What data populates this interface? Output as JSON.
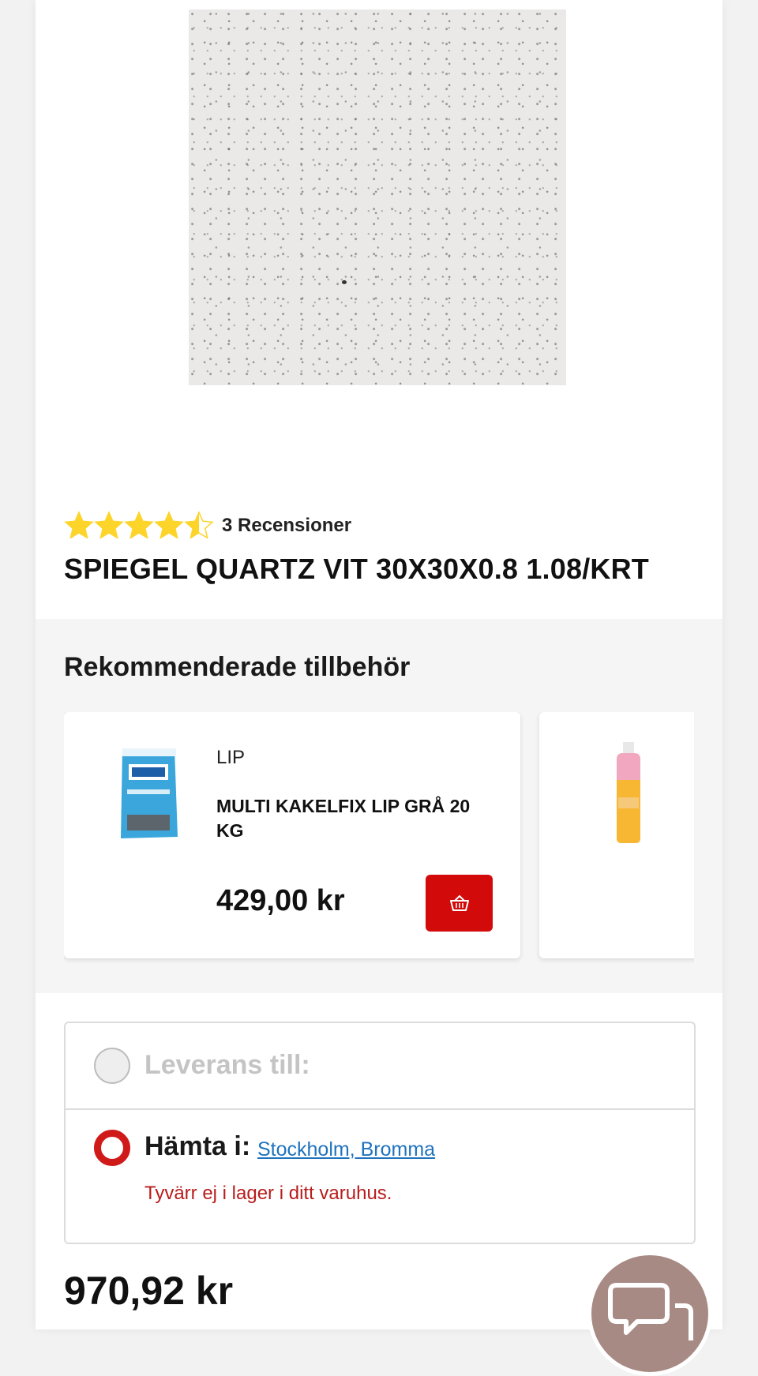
{
  "product": {
    "image_alt": "SPIEGEL QUARTZ VIT 30X30X0.8 1.08/KRT",
    "rating_value": 4.5,
    "rating_max": 5,
    "reviews_text": "3 Recensioner",
    "title": "SPIEGEL QUARTZ VIT 30X30X0.8 1.08/KRT"
  },
  "accessories": {
    "heading": "Rekommenderade tillbehör",
    "items": [
      {
        "brand": "LIP",
        "name": "MULTI KAKELFIX LIP GRÅ 20 KG",
        "price": "429,00 kr",
        "icon": "basket-icon"
      },
      {
        "brand": "",
        "name": "",
        "price": "",
        "icon": "basket-icon"
      }
    ]
  },
  "delivery": {
    "option_delivery_label": "Leverans till:",
    "option_pickup_label": "Hämta i:",
    "store": "Stockholm, Bromma",
    "stock_message": "Tyvärr ej i lager i ditt varuhus."
  },
  "price": {
    "total": "970,92 kr"
  },
  "colors": {
    "accent_red": "#d20a0a",
    "link_blue": "#1e73be",
    "star_yellow": "#fdd42a",
    "chat_bubble": "#a88a85"
  }
}
